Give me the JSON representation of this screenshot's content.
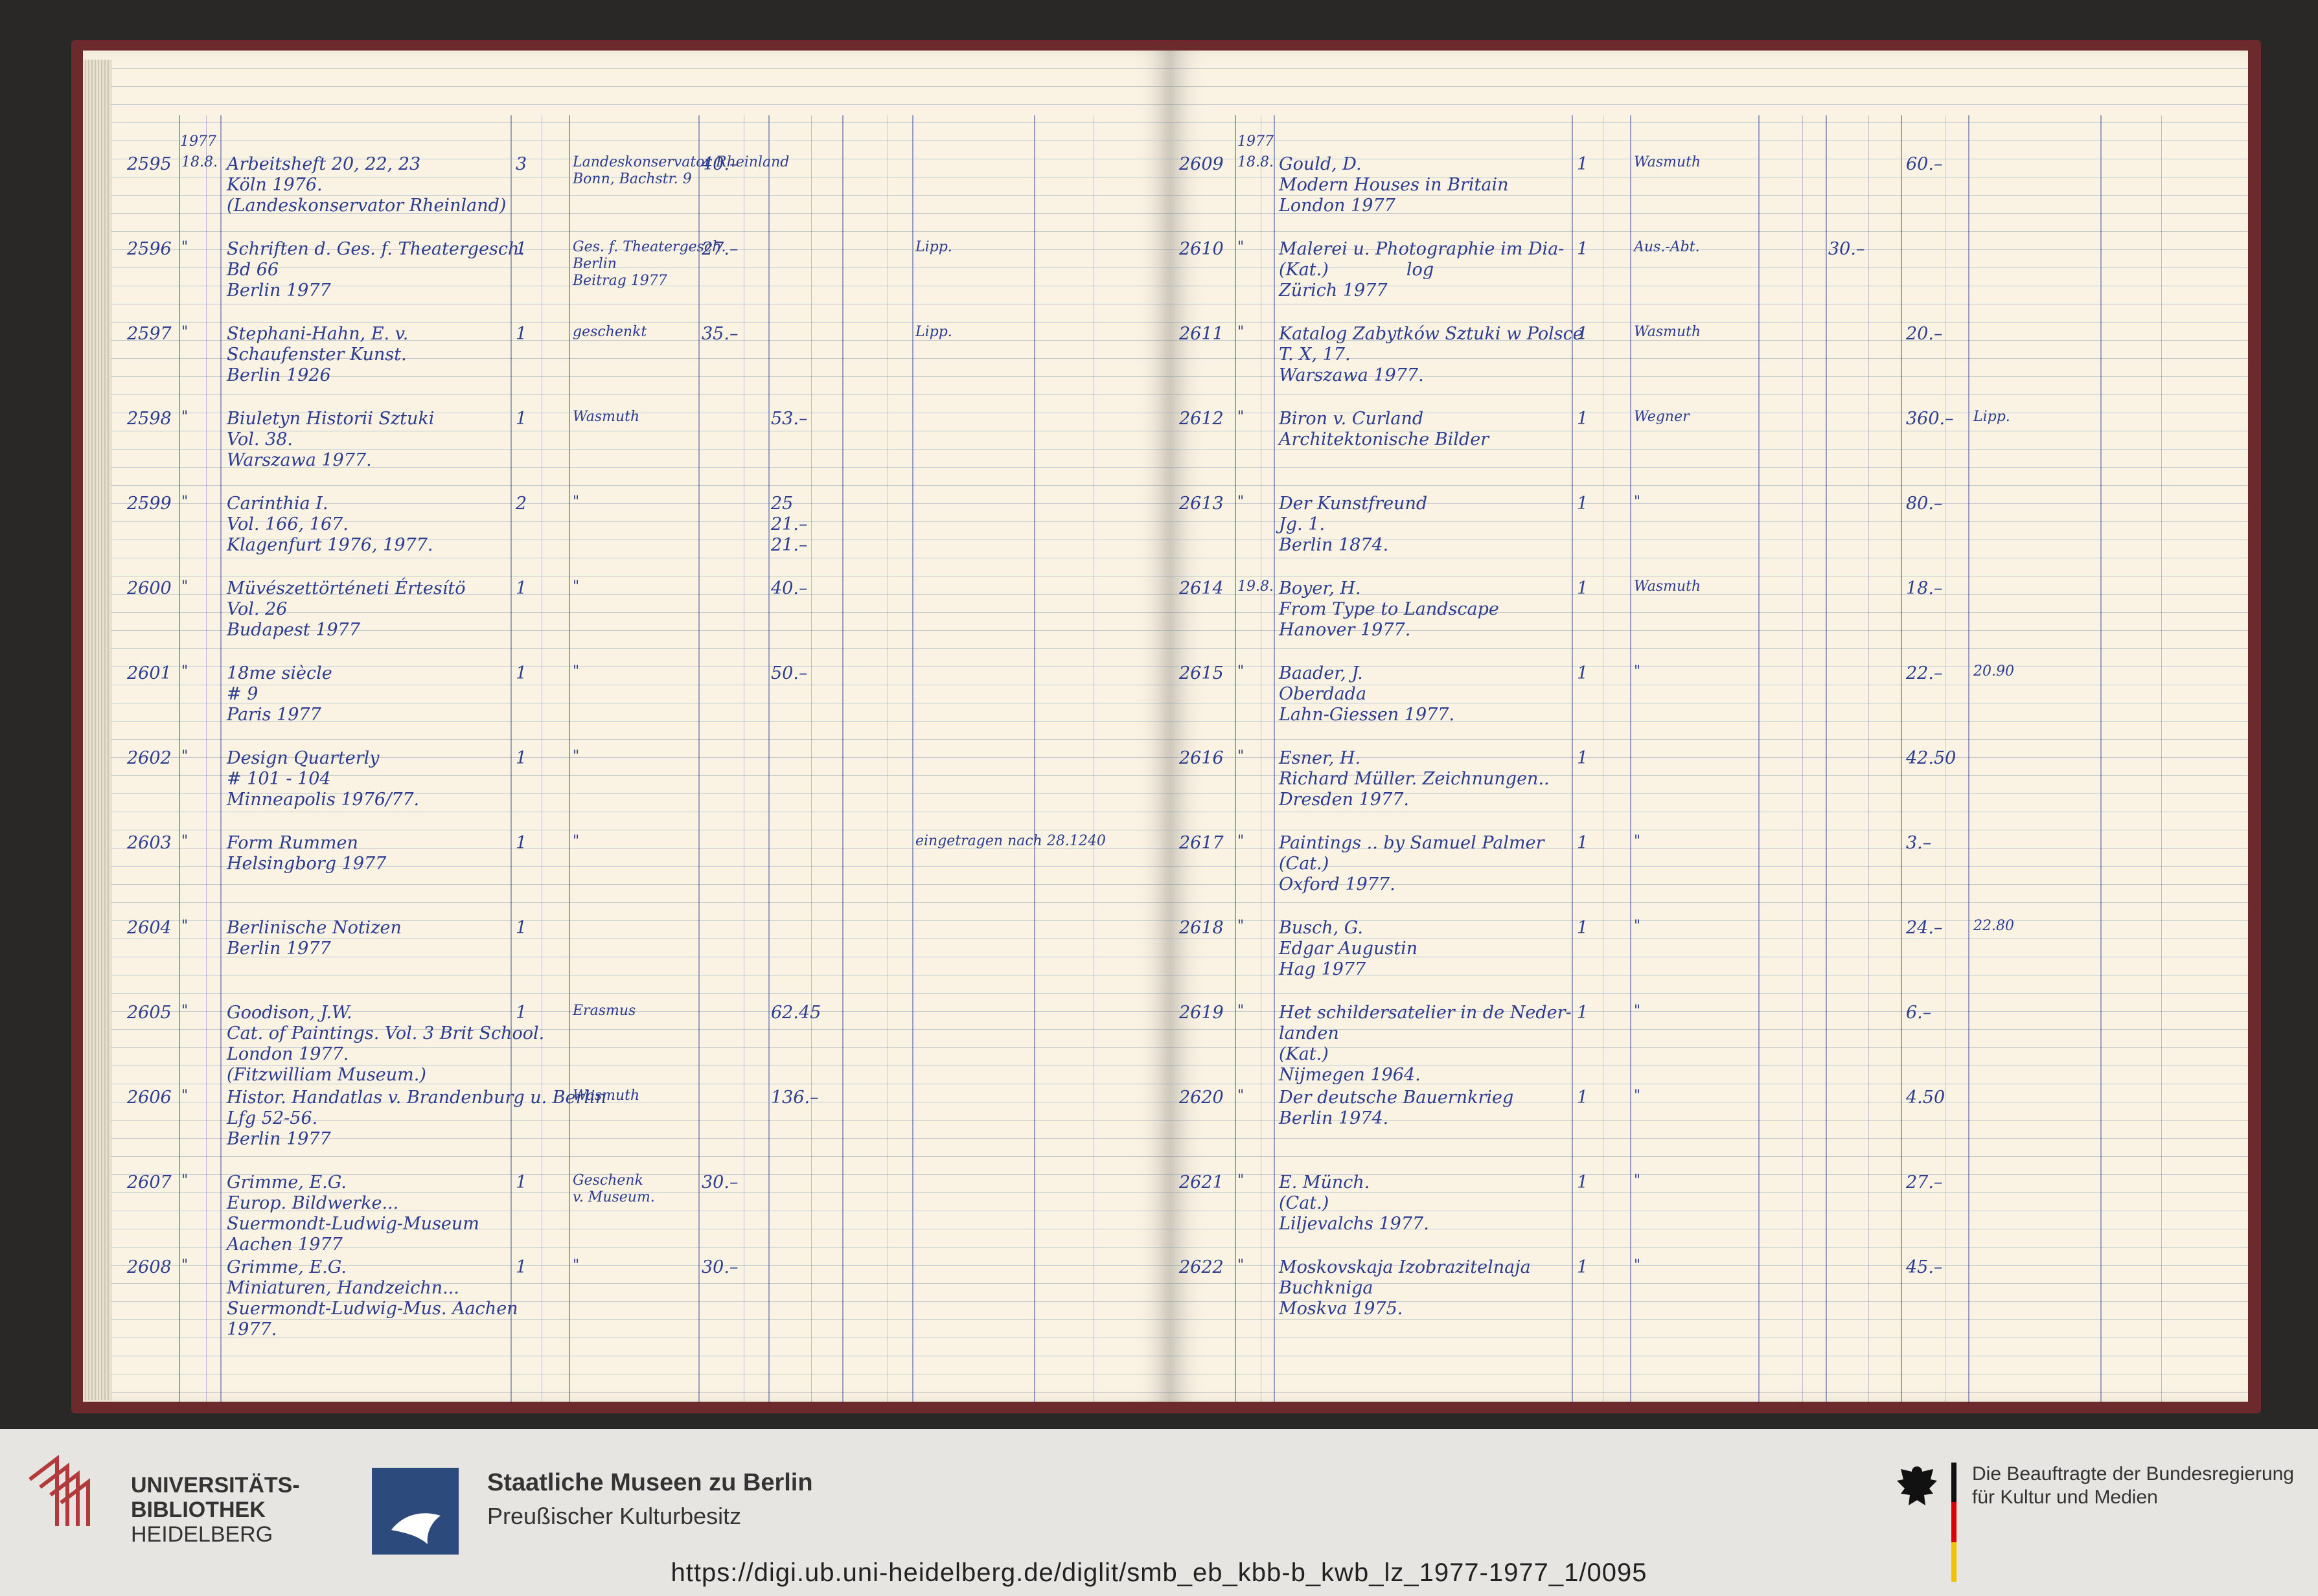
{
  "ledger": {
    "left_page": {
      "year_header": "1977",
      "entries": [
        {
          "num": "2595",
          "date": "18.8.",
          "desc": "Arbeitsheft 20, 22, 23\nKöln 1976.\n(Landeskonservator Rheinland)",
          "qty": "3",
          "source": "Landeskonservator Rheinland\nBonn, Bachstr. 9",
          "price": "40.–",
          "price2": "",
          "note": ""
        },
        {
          "num": "2596",
          "date": "\"",
          "desc": "Schriften d. Ges. f. Theatergesch.\nBd 66\nBerlin 1977",
          "qty": "1",
          "source": "Ges. f. Theatergesch.\nBerlin\nBeitrag 1977",
          "price": "27.–",
          "price2": "",
          "note": "Lipp."
        },
        {
          "num": "2597",
          "date": "\"",
          "desc": "Stephani-Hahn, E. v.\nSchaufenster Kunst.\nBerlin 1926",
          "qty": "1",
          "source": "geschenkt",
          "price": "35.–",
          "price2": "",
          "note": "Lipp."
        },
        {
          "num": "2598",
          "date": "\"",
          "desc": "Biuletyn Historii Sztuki\nVol. 38.\nWarszawa 1977.",
          "qty": "1",
          "source": "Wasmuth",
          "price": "",
          "price2": "53.–",
          "note": ""
        },
        {
          "num": "2599",
          "date": "\"",
          "desc": "Carinthia I.\nVol. 166, 167.\nKlagenfurt 1976, 1977.",
          "qty": "2",
          "source": "\"",
          "price": "",
          "price2": "25\n21.–\n21.–",
          "note": ""
        },
        {
          "num": "2600",
          "date": "\"",
          "desc": "Müvészettörténeti Értesítö\nVol. 26\nBudapest 1977",
          "qty": "1",
          "source": "\"",
          "price": "",
          "price2": "40.–",
          "note": ""
        },
        {
          "num": "2601",
          "date": "\"",
          "desc": "18me siècle\n# 9\nParis 1977",
          "qty": "1",
          "source": "\"",
          "price": "",
          "price2": "50.–",
          "note": ""
        },
        {
          "num": "2602",
          "date": "\"",
          "desc": "Design Quarterly\n# 101 - 104\nMinneapolis 1976/77.",
          "qty": "1",
          "source": "\"",
          "price": "",
          "price2": "",
          "note": ""
        },
        {
          "num": "2603",
          "date": "\"",
          "desc": "Form Rummen\nHelsingborg 1977",
          "qty": "1",
          "source": "\"",
          "price": "",
          "price2": "",
          "note": "eingetragen nach 28.1240"
        },
        {
          "num": "2604",
          "date": "\"",
          "desc": "Berlinische Notizen\nBerlin 1977",
          "qty": "1",
          "source": "",
          "price": "",
          "price2": "",
          "note": ""
        },
        {
          "num": "2605",
          "date": "\"",
          "desc": "Goodison, J.W.\nCat. of Paintings. Vol. 3 Brit School.\nLondon 1977.\n(Fitzwilliam Museum.)",
          "qty": "1",
          "source": "Erasmus",
          "price": "",
          "price2": "62.45",
          "note": ""
        },
        {
          "num": "2606",
          "date": "\"",
          "desc": "Histor. Handatlas v. Brandenburg u. Berlin\nLfg 52-56.\nBerlin 1977",
          "qty": "",
          "source": "Wasmuth",
          "price": "",
          "price2": "136.–",
          "note": ""
        },
        {
          "num": "2607",
          "date": "\"",
          "desc": "Grimme, E.G.\nEurop. Bildwerke...\nSuermondt-Ludwig-Museum\nAachen 1977",
          "qty": "1",
          "source": "Geschenk\nv. Museum.",
          "price": "30.–",
          "price2": "",
          "note": ""
        },
        {
          "num": "2608",
          "date": "\"",
          "desc": "Grimme, E.G.\nMiniaturen, Handzeichn...\nSuermondt-Ludwig-Mus. Aachen\n1977.",
          "qty": "1",
          "source": "\"",
          "price": "30.–",
          "price2": "",
          "note": ""
        }
      ]
    },
    "right_page": {
      "year_header": "1977",
      "entries": [
        {
          "num": "2609",
          "date": "18.8.",
          "desc": "Gould, D.\nModern Houses in Britain\nLondon 1977",
          "qty": "1",
          "source": "Wasmuth",
          "price": "",
          "price2": "60.–",
          "note": ""
        },
        {
          "num": "2610",
          "date": "\"",
          "desc": "Malerei u. Photographie im Dia-\n(Kat.)              log\nZürich 1977",
          "qty": "1",
          "source": "Aus.-Abt.",
          "price": "30.–",
          "price2": "",
          "note": ""
        },
        {
          "num": "2611",
          "date": "\"",
          "desc": "Katalog Zabytków Sztuki w Polsce\nT. X, 17.\nWarszawa 1977.",
          "qty": "1",
          "source": "Wasmuth",
          "price": "",
          "price2": "20.–",
          "note": ""
        },
        {
          "num": "2612",
          "date": "\"",
          "desc": "Biron v. Curland\nArchitektonische Bilder",
          "qty": "1",
          "source": "Wegner",
          "price": "",
          "price2": "360.–",
          "note": "Lipp."
        },
        {
          "num": "2613",
          "date": "\"",
          "desc": "Der Kunstfreund\nJg. 1.\nBerlin 1874.",
          "qty": "1",
          "source": "\"",
          "price": "",
          "price2": "80.–",
          "note": ""
        },
        {
          "num": "2614",
          "date": "19.8.",
          "desc": "Boyer, H.\nFrom Type to Landscape\nHanover 1977.",
          "qty": "1",
          "source": "Wasmuth",
          "price": "",
          "price2": "18.–",
          "note": ""
        },
        {
          "num": "2615",
          "date": "\"",
          "desc": "Baader, J.\nOberdada\nLahn-Giessen 1977.",
          "qty": "1",
          "source": "\"",
          "price": "",
          "price2": "22.–",
          "note": "20.90"
        },
        {
          "num": "2616",
          "date": "\"",
          "desc": "Esner, H.\nRichard Müller. Zeichnungen..\nDresden 1977.",
          "qty": "1",
          "source": "",
          "price": "",
          "price2": "42.50",
          "note": ""
        },
        {
          "num": "2617",
          "date": "\"",
          "desc": "Paintings .. by Samuel Palmer\n(Cat.)\nOxford 1977.",
          "qty": "1",
          "source": "\"",
          "price": "",
          "price2": "3.–",
          "note": ""
        },
        {
          "num": "2618",
          "date": "\"",
          "desc": "Busch, G.\nEdgar Augustin\nHag 1977",
          "qty": "1",
          "source": "\"",
          "price": "",
          "price2": "24.–",
          "note": "22.80"
        },
        {
          "num": "2619",
          "date": "\"",
          "desc": "Het schildersatelier in de Neder-\nlanden\n(Kat.)\nNijmegen 1964.",
          "qty": "1",
          "source": "\"",
          "price": "",
          "price2": "6.–",
          "note": ""
        },
        {
          "num": "2620",
          "date": "\"",
          "desc": "Der deutsche Bauernkrieg\nBerlin 1974.",
          "qty": "1",
          "source": "\"",
          "price": "",
          "price2": "4.50",
          "note": ""
        },
        {
          "num": "2621",
          "date": "\"",
          "desc": "E. Münch.\n(Cat.)\nLiljevalchs 1977.",
          "qty": "1",
          "source": "\"",
          "price": "",
          "price2": "27.–",
          "note": ""
        },
        {
          "num": "2622",
          "date": "\"",
          "desc": "Moskovskaja Izobrazitelnaja\nBuchkniga\nMoskva 1975.",
          "qty": "1",
          "source": "\"",
          "price": "",
          "price2": "45.–",
          "note": ""
        }
      ]
    }
  },
  "footer": {
    "uni_name_line1": "UNIVERSITÄTS-",
    "uni_name_line2": "BIBLIOTHEK",
    "uni_city": "HEIDELBERG",
    "smb_name": "Staatliche Museen zu Berlin",
    "smb_sub": "Preußischer Kulturbesitz",
    "bkm_line1": "Die Beauftragte der Bundesregierung",
    "bkm_line2": "für Kultur und Medien",
    "url": "https://digi.ub.uni-heidelberg.de/diglit/smb_eb_kbb-b_kwb_lz_1977-1977_1/0095"
  },
  "colors": {
    "paper": "#faf3e4",
    "ink": "#2c3c8f",
    "uni_red": "#b23a3a",
    "smb_blue": "#2d4a7d"
  }
}
